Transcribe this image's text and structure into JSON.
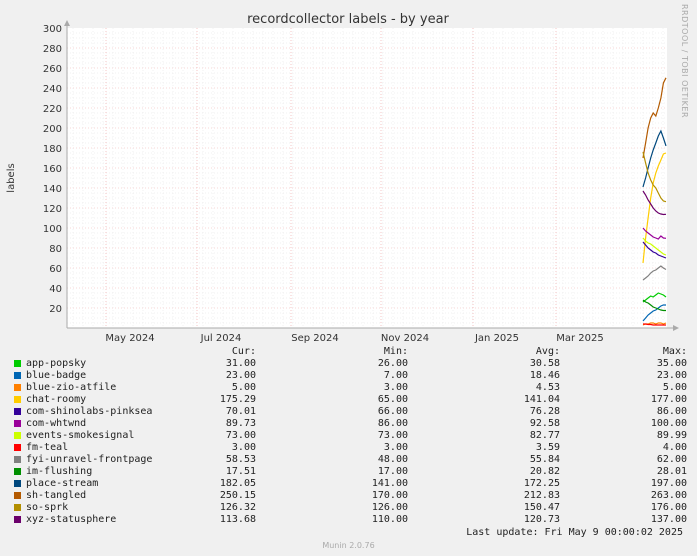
{
  "chart_data": {
    "type": "line",
    "title": "recordcollector labels - by year",
    "ylabel": "labels",
    "xlabel": "",
    "ylim": [
      0,
      300
    ],
    "yticks": [
      20,
      40,
      60,
      80,
      100,
      120,
      140,
      160,
      180,
      200,
      220,
      240,
      260,
      280,
      300
    ],
    "xticks": [
      "May 2024",
      "Jul 2024",
      "Sep 2024",
      "Nov 2024",
      "Jan 2025",
      "Mar 2025"
    ],
    "grid": true,
    "series": [
      {
        "name": "app-popsky",
        "color": "#00cc00",
        "values": [
          26,
          28,
          30,
          32,
          31,
          33,
          35,
          34,
          33,
          31
        ]
      },
      {
        "name": "blue-badge",
        "color": "#0066b3",
        "values": [
          7,
          10,
          13,
          15,
          17,
          18,
          20,
          22,
          23,
          23
        ]
      },
      {
        "name": "blue-zio-atfile",
        "color": "#ff8000",
        "values": [
          3,
          4,
          4,
          5,
          5,
          4,
          5,
          5,
          4,
          5
        ]
      },
      {
        "name": "chat-roomy",
        "color": "#ffcc00",
        "values": [
          65,
          90,
          110,
          130,
          145,
          155,
          162,
          168,
          174,
          175
        ]
      },
      {
        "name": "com-shinolabs-pinksea",
        "color": "#330099",
        "values": [
          86,
          83,
          80,
          78,
          76,
          75,
          73,
          72,
          71,
          70
        ]
      },
      {
        "name": "com-whtwnd",
        "color": "#990099",
        "values": [
          100,
          97,
          95,
          93,
          91,
          90,
          89,
          92,
          90,
          89.73
        ]
      },
      {
        "name": "events-smokesignal",
        "color": "#ccff00",
        "values": [
          89.99,
          87,
          85,
          84,
          82,
          80,
          78,
          76,
          74,
          73
        ]
      },
      {
        "name": "fm-teal",
        "color": "#ff0000",
        "values": [
          4,
          4,
          3.5,
          3.5,
          3,
          3,
          3,
          3,
          3,
          3
        ]
      },
      {
        "name": "fyi-unravel-frontpage",
        "color": "#808080",
        "values": [
          48,
          50,
          52,
          55,
          57,
          58,
          60,
          62,
          60,
          58.53
        ]
      },
      {
        "name": "im-flushing",
        "color": "#008f00",
        "values": [
          28,
          26,
          25,
          23,
          21,
          20,
          19,
          18,
          17.5,
          17.51
        ]
      },
      {
        "name": "place-stream",
        "color": "#00487d",
        "values": [
          141,
          150,
          160,
          170,
          178,
          185,
          192,
          197,
          190,
          182.05
        ]
      },
      {
        "name": "sh-tangled",
        "color": "#b35a00",
        "values": [
          170,
          185,
          200,
          210,
          215,
          212,
          220,
          230,
          245,
          250.15
        ]
      },
      {
        "name": "so-sprk",
        "color": "#b38f00",
        "values": [
          176,
          165,
          155,
          148,
          143,
          140,
          135,
          130,
          127,
          126.32
        ]
      },
      {
        "name": "xyz-statusphere",
        "color": "#6b006b",
        "values": [
          137,
          133,
          128,
          124,
          120,
          117,
          115,
          114,
          113.5,
          113.68
        ]
      }
    ]
  },
  "legend": {
    "headers": {
      "cur": "Cur:",
      "min": "Min:",
      "avg": "Avg:",
      "max": "Max:"
    },
    "rows": [
      {
        "name": "app-popsky",
        "color": "#00cc00",
        "cur": "31.00",
        "min": "26.00",
        "avg": "30.58",
        "max": "35.00"
      },
      {
        "name": "blue-badge",
        "color": "#0066b3",
        "cur": "23.00",
        "min": "7.00",
        "avg": "18.46",
        "max": "23.00"
      },
      {
        "name": "blue-zio-atfile",
        "color": "#ff8000",
        "cur": "5.00",
        "min": "3.00",
        "avg": "4.53",
        "max": "5.00"
      },
      {
        "name": "chat-roomy",
        "color": "#ffcc00",
        "cur": "175.29",
        "min": "65.00",
        "avg": "141.04",
        "max": "177.00"
      },
      {
        "name": "com-shinolabs-pinksea",
        "color": "#330099",
        "cur": "70.01",
        "min": "66.00",
        "avg": "76.28",
        "max": "86.00"
      },
      {
        "name": "com-whtwnd",
        "color": "#990099",
        "cur": "89.73",
        "min": "86.00",
        "avg": "92.58",
        "max": "100.00"
      },
      {
        "name": "events-smokesignal",
        "color": "#ccff00",
        "cur": "73.00",
        "min": "73.00",
        "avg": "82.77",
        "max": "89.99"
      },
      {
        "name": "fm-teal",
        "color": "#ff0000",
        "cur": "3.00",
        "min": "3.00",
        "avg": "3.59",
        "max": "4.00"
      },
      {
        "name": "fyi-unravel-frontpage",
        "color": "#808080",
        "cur": "58.53",
        "min": "48.00",
        "avg": "55.84",
        "max": "62.00"
      },
      {
        "name": "im-flushing",
        "color": "#008f00",
        "cur": "17.51",
        "min": "17.00",
        "avg": "20.82",
        "max": "28.01"
      },
      {
        "name": "place-stream",
        "color": "#00487d",
        "cur": "182.05",
        "min": "141.00",
        "avg": "172.25",
        "max": "197.00"
      },
      {
        "name": "sh-tangled",
        "color": "#b35a00",
        "cur": "250.15",
        "min": "170.00",
        "avg": "212.83",
        "max": "263.00"
      },
      {
        "name": "so-sprk",
        "color": "#b38f00",
        "cur": "126.32",
        "min": "126.00",
        "avg": "150.47",
        "max": "176.00"
      },
      {
        "name": "xyz-statusphere",
        "color": "#6b006b",
        "cur": "113.68",
        "min": "110.00",
        "avg": "120.73",
        "max": "137.00"
      }
    ]
  },
  "last_update": "Last update: Fri May  9 00:00:02 2025",
  "footer": "Munin 2.0.76",
  "side_label": "RRDTOOL / TOBI OETIKER"
}
